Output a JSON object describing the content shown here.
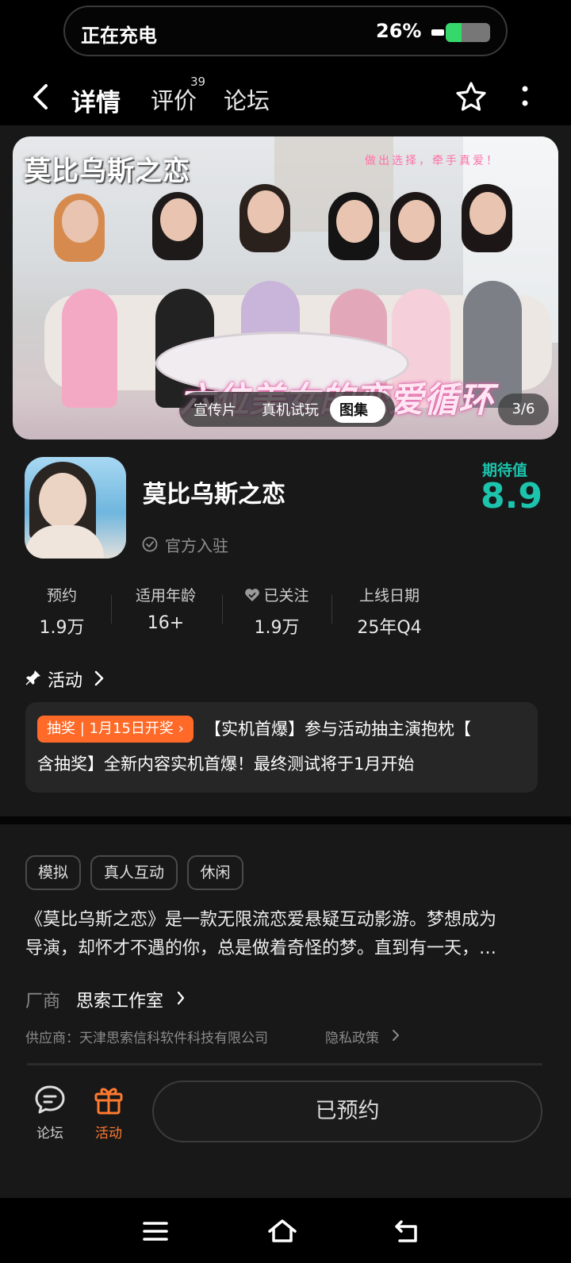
{
  "status": {
    "charging": "正在充电",
    "battery_pct": "26%",
    "battery_level": 0.26,
    "battery_color": "#35d86b"
  },
  "nav": {
    "tabs": [
      {
        "label": "详情",
        "active": true
      },
      {
        "label": "评价",
        "count": "39"
      },
      {
        "label": "论坛"
      }
    ],
    "accent": "#12b5a1"
  },
  "banner": {
    "title": "莫比乌斯之恋",
    "slogan": "做出选择，牵手真爱！",
    "bottom_text": "六位美女的恋爱循环",
    "media_tabs": [
      "宣传片",
      "真机试玩",
      "图集"
    ],
    "active_media_tab": "图集",
    "page": "3/6"
  },
  "game": {
    "title": "莫比乌斯之恋",
    "verified": "官方入驻",
    "expect_label": "期待值",
    "expect_value": "8.9",
    "accent": "#1cc3ad"
  },
  "stats": [
    {
      "label": "预约",
      "value": "1.9万"
    },
    {
      "label": "适用年龄",
      "value": "16+"
    },
    {
      "label": "已关注",
      "value": "1.9万"
    },
    {
      "label": "上线日期",
      "value": "25年Q4"
    }
  ],
  "activity": {
    "header": "活动",
    "badge": "抽奖 | 1月15日开奖",
    "text_line1": "【实机首爆】参与活动抽主演抱枕【",
    "text_line2": "含抽奖】全新内容实机首爆！最终测试将于1月开始",
    "badge_color": "#ff6a28"
  },
  "tags": [
    "模拟",
    "真人互动",
    "休闲"
  ],
  "description": {
    "line1": "《莫比乌斯之恋》是一款无限流恋爱悬疑互动影游。梦想成为",
    "line2": "导演，却怀才不遇的你，总是做着奇怪的梦。直到有一天，…"
  },
  "vendor": {
    "label": "厂商",
    "name": "思索工作室"
  },
  "supplier": "供应商：天津思索信科软件科技有限公司",
  "privacy": "隐私政策",
  "bottom_bar": {
    "forum_label": "论坛",
    "event_label": "活动",
    "reserve_label": "已预约",
    "event_color": "#ff7a30"
  }
}
